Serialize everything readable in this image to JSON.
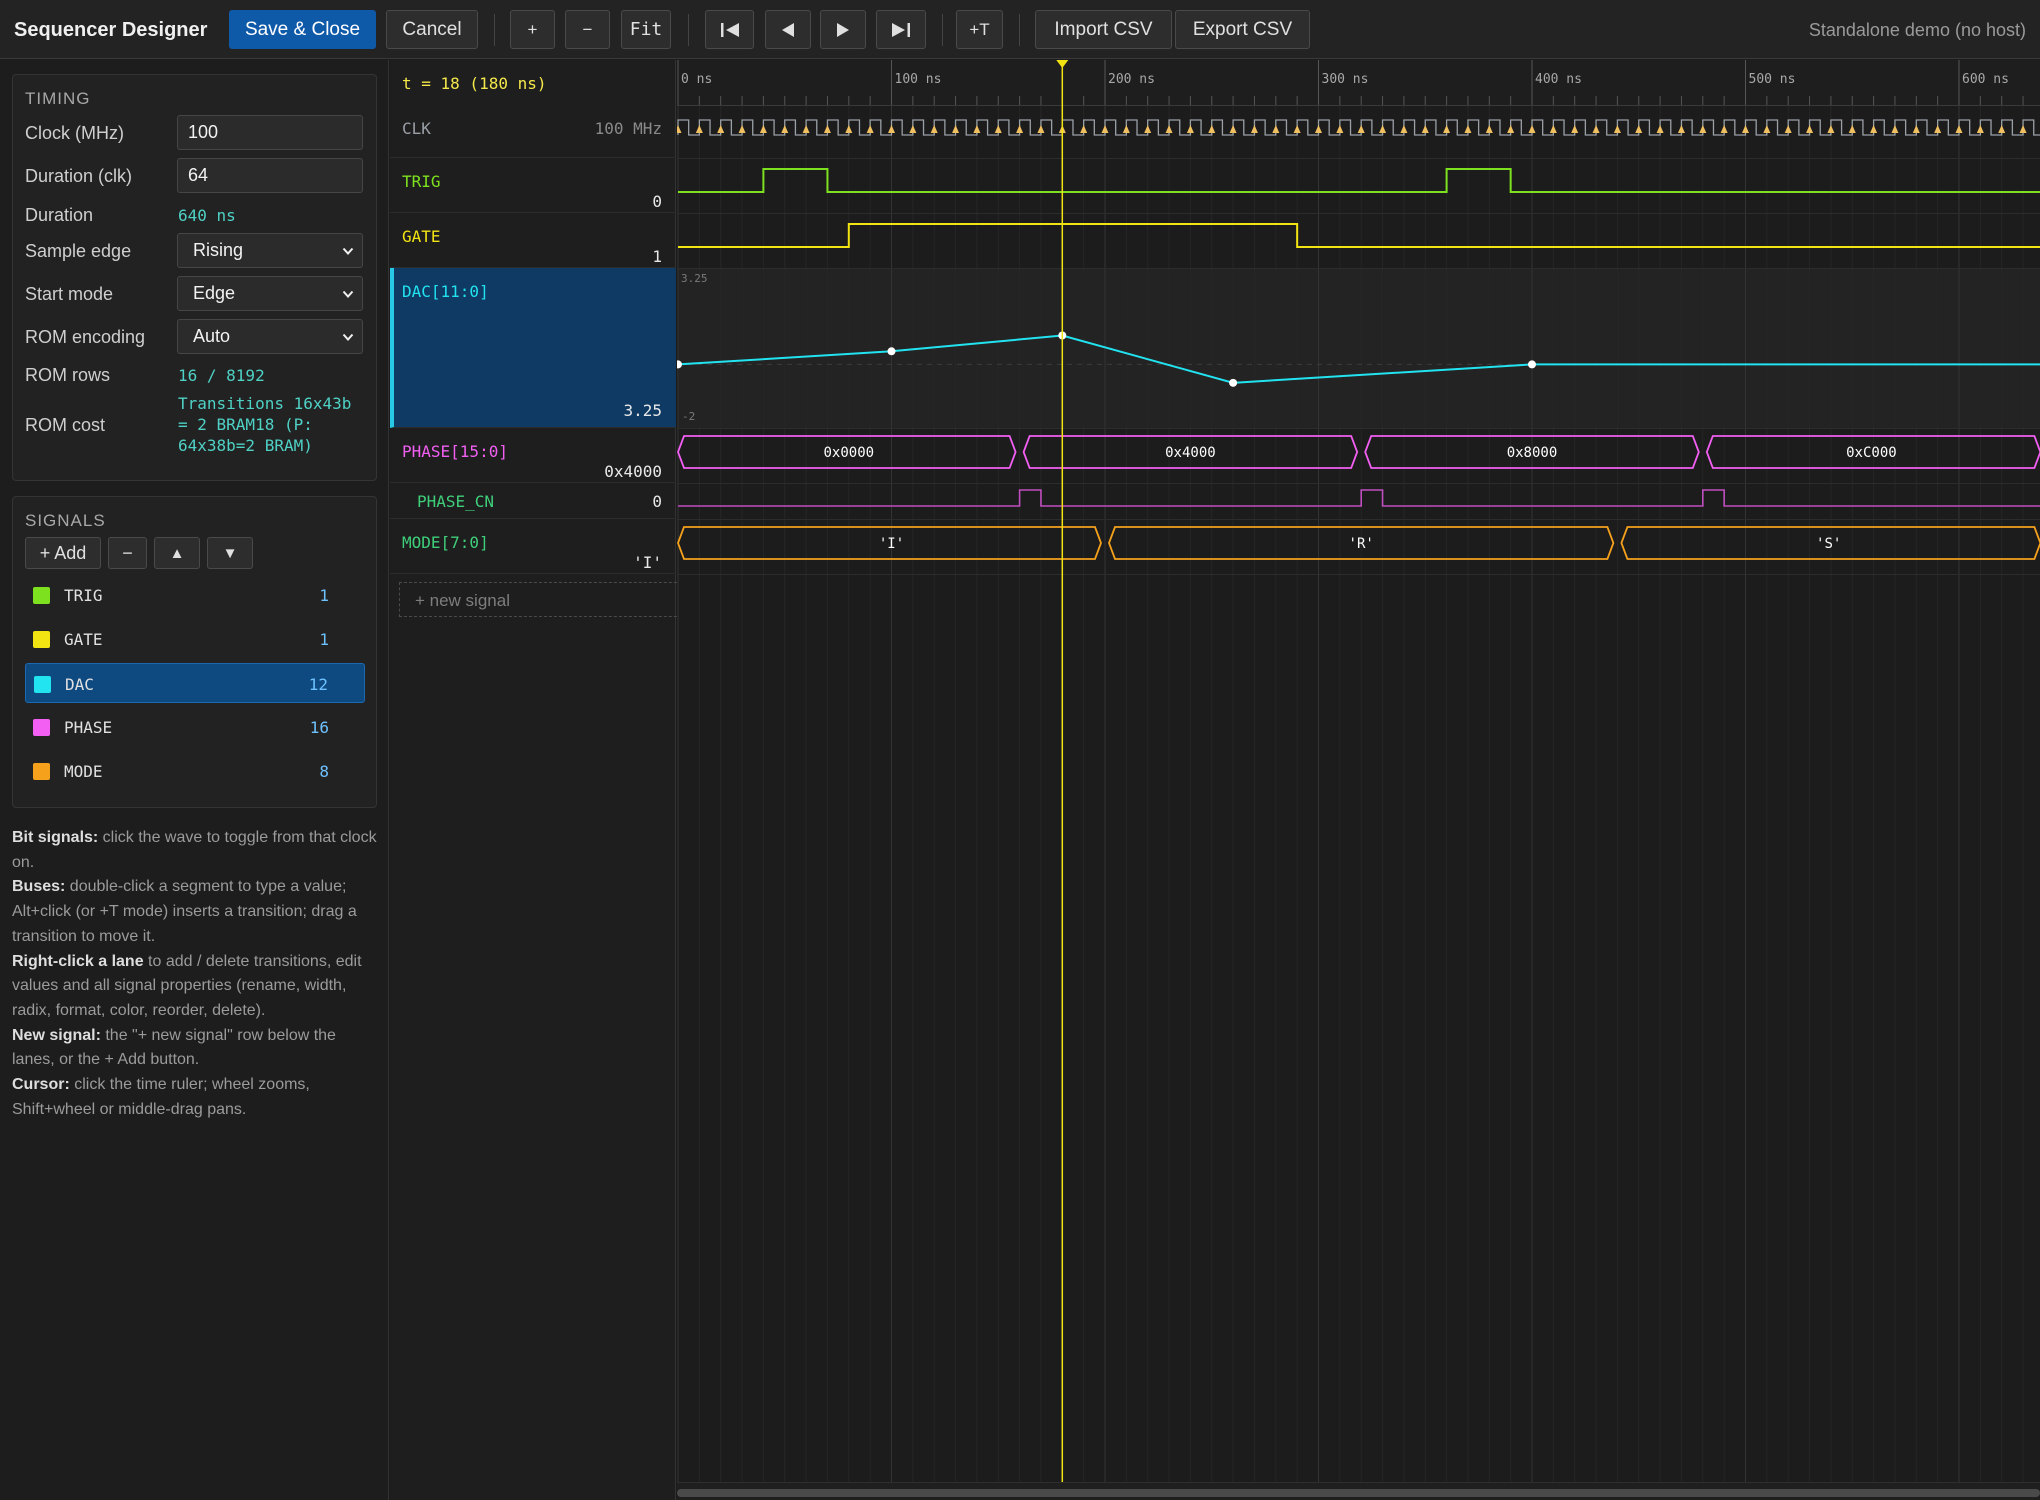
{
  "toolbar": {
    "title": "Sequencer Designer",
    "save_close": "Save & Close",
    "cancel": "Cancel",
    "zoom_in": "+",
    "zoom_out": "−",
    "fit": "Fit",
    "insert_transition": "+T",
    "import_csv": "Import CSV",
    "export_csv": "Export CSV",
    "host_status": "Standalone demo (no host)"
  },
  "timing": {
    "title": "TIMING",
    "clock_label": "Clock (MHz)",
    "clock_value": "100",
    "duration_clk_label": "Duration (clk)",
    "duration_clk_value": "64",
    "duration_label": "Duration",
    "duration_value": "640 ns",
    "sample_edge_label": "Sample edge",
    "sample_edge_value": "Rising",
    "start_mode_label": "Start mode",
    "start_mode_value": "Edge",
    "rom_encoding_label": "ROM encoding",
    "rom_encoding_value": "Auto",
    "rom_rows_label": "ROM rows",
    "rom_rows_value": "16 / 8192",
    "rom_cost_label": "ROM cost",
    "rom_cost_line1": "Transitions 16x43b",
    "rom_cost_line2": "= 2 BRAM18 (P:",
    "rom_cost_line3": "64x38b=2 BRAM)"
  },
  "signals": {
    "title": "SIGNALS",
    "add_label": "+ Add",
    "remove_label": "−",
    "up_label": "▲",
    "down_label": "▼",
    "items": [
      {
        "name": "TRIG",
        "width": "1",
        "color": "#7ee11f"
      },
      {
        "name": "GATE",
        "width": "1",
        "color": "#f2e313"
      },
      {
        "name": "DAC",
        "width": "12",
        "color": "#22e3f0"
      },
      {
        "name": "PHASE",
        "width": "16",
        "color": "#f25ff2"
      },
      {
        "name": "MODE",
        "width": "8",
        "color": "#f5a11c"
      }
    ]
  },
  "help": [
    {
      "b": "Bit signals:",
      "t": " click the wave to toggle from that clock on."
    },
    {
      "b": "Buses:",
      "t": " double-click a segment to type a value; Alt+click (or +T mode) inserts a transition; drag a transition to move it."
    },
    {
      "b": "Right-click a lane",
      "t": " to add / delete transitions, edit values and all signal properties (rename, width, radix, format, color, reorder, delete)."
    },
    {
      "b": "New signal:",
      "t": " the \"+ new signal\" row below the lanes, or the + Add button."
    },
    {
      "b": "Cursor:",
      "t": " click the time ruler; wheel zooms, Shift+wheel or middle-drag pans."
    }
  ],
  "cursor": {
    "readout": "t = 18  (180 ns)",
    "clk": 18
  },
  "lanes": [
    {
      "name": "CLK",
      "value": "100 MHz",
      "color": "#9aa0a6"
    },
    {
      "name": "TRIG",
      "value": "0",
      "color": "#7ee11f"
    },
    {
      "name": "GATE",
      "value": "1",
      "color": "#f2e313"
    },
    {
      "name": "DAC[11:0]",
      "value": "3.25",
      "color": "#22e3f0"
    },
    {
      "name": "PHASE[15:0]",
      "value": "0x4000",
      "color": "#f25ff2"
    },
    {
      "name": "PHASE_CN",
      "value": "0",
      "color": "#3fcf7a"
    },
    {
      "name": "MODE[7:0]",
      "value": "'I'",
      "color": "#3fcf7a"
    }
  ],
  "new_signal_label": "+ new signal",
  "ruler": {
    "labels": [
      "0 ns",
      "100 ns",
      "200 ns",
      "300 ns",
      "400 ns",
      "500 ns",
      "600 ns"
    ]
  },
  "waves": {
    "trig_pulses": [
      [
        4,
        7
      ],
      [
        36,
        39
      ]
    ],
    "gate_high": [
      [
        8,
        29
      ]
    ],
    "dac": {
      "max_label": "3.25",
      "min_label": "-2",
      "points": [
        [
          0,
          0
        ],
        [
          10,
          0.5
        ],
        [
          18,
          1.1
        ],
        [
          26,
          -0.7
        ],
        [
          40,
          0
        ],
        [
          64,
          0
        ]
      ]
    },
    "phase_segments": [
      {
        "start": 0,
        "end": 16,
        "label": "0x0000"
      },
      {
        "start": 16,
        "end": 32,
        "label": "0x4000"
      },
      {
        "start": 32,
        "end": 48,
        "label": "0x8000"
      },
      {
        "start": 48,
        "end": 64,
        "label": "0xC000"
      }
    ],
    "phase_cn_pulses": [
      16,
      32,
      48
    ],
    "mode_segments": [
      {
        "start": 0,
        "end": 20,
        "label": "'I'"
      },
      {
        "start": 20,
        "end": 44,
        "label": "'R'"
      },
      {
        "start": 44,
        "end": 64,
        "label": "'S'"
      }
    ]
  }
}
